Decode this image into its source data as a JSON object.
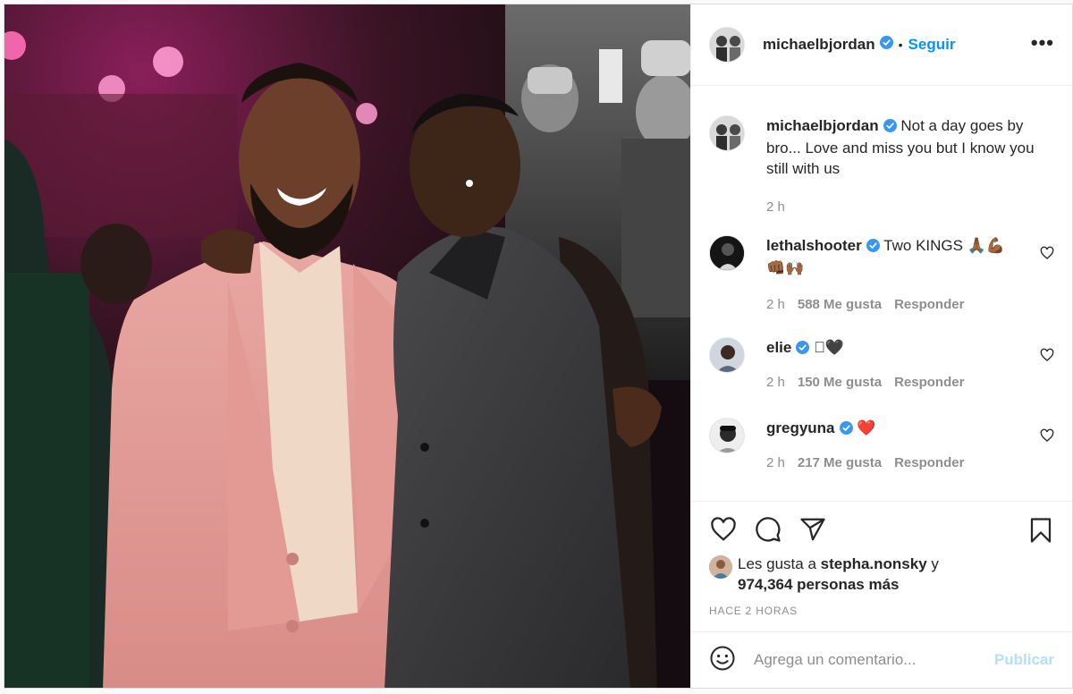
{
  "header": {
    "username": "michaelbjordan",
    "separator": "•",
    "follow_label": "Seguir",
    "more_label": "•••"
  },
  "caption": {
    "username": "michaelbjordan",
    "text": "Not a day goes by bro... Love and miss you but I know you still with us",
    "time": "2 h"
  },
  "comments": [
    {
      "username": "lethalshooter",
      "text": "Two KINGS 🙏🏾💪🏾👊🏾🙌🏾",
      "time": "2 h",
      "likes": "588 Me gusta",
      "reply": "Responder"
    },
    {
      "username": "elie",
      "text": "🏾🖤",
      "time": "2 h",
      "likes": "150 Me gusta",
      "reply": "Responder"
    },
    {
      "username": "gregyuna",
      "text": "❤️",
      "time": "2 h",
      "likes": "217 Me gusta",
      "reply": "Responder"
    }
  ],
  "likes": {
    "prefix": "Les gusta a ",
    "user": "stepha.nonsky",
    "joiner": " y",
    "count": "974,364 personas más"
  },
  "timestamp": "HACE 2 HORAS",
  "add_comment": {
    "placeholder": "Agrega un comentario...",
    "post_label": "Publicar"
  },
  "colors": {
    "link": "#0095f6",
    "verified": "#3897f0",
    "muted": "#8e8e8e"
  }
}
